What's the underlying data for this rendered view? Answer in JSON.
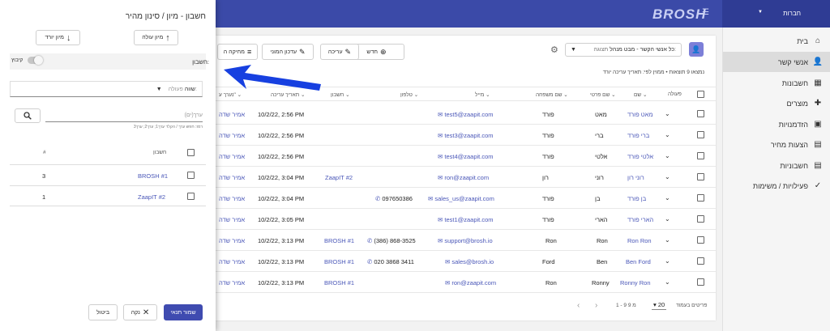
{
  "header": {
    "logo": "BROSH",
    "menu_icon": "menu-collapse-icon",
    "company": "חברות"
  },
  "sidebar": {
    "items": [
      {
        "label": "בית",
        "icon": "⌂"
      },
      {
        "label": "אנשי קשר",
        "icon": "👤"
      },
      {
        "label": "חשבונות",
        "icon": "▦"
      },
      {
        "label": "מוצרים",
        "icon": "✚"
      },
      {
        "label": "הזדמנויות",
        "icon": "▣"
      },
      {
        "label": "הצעות מחיר",
        "icon": "▤"
      },
      {
        "label": "חשבוניות",
        "icon": "▤"
      },
      {
        "label": "פעילויות / משימות",
        "icon": "✓"
      }
    ]
  },
  "toolbar": {
    "new": "חדש",
    "edit": "עריכה",
    "mass_update": "עדכון המוני",
    "delete": "מחיקה ה"
  },
  "view": {
    "label": "תצוגה:",
    "value": "כל אנשי הקשר - מבט מנהל"
  },
  "results_text": "נמצאו 9 תוצאות • ממוין לפי: תאריך עריכה יורד",
  "table": {
    "headers": {
      "action": "פעולה",
      "name": "שם",
      "first_name": "שם פרטי",
      "last_name": "שם משפחה",
      "email": "מייל",
      "phone": "טלפון",
      "account": "חשבון",
      "modified": "תאריך עריכה",
      "modified_by": "נערך ע\""
    },
    "rows": [
      {
        "name": "מאט פורד",
        "first": "מאט",
        "last": "פורד",
        "email": "test5@zaapit.com",
        "phone": "",
        "account": "",
        "account_num": "",
        "date": "10/2/22, 2:56 PM",
        "by": "אמיר שדה"
      },
      {
        "name": "ברי פורד",
        "first": "ברי",
        "last": "פורד",
        "email": "test3@zaapit.com",
        "phone": "",
        "account": "",
        "account_num": "",
        "date": "10/2/22, 2:56 PM",
        "by": "אמיר שדה"
      },
      {
        "name": "אלטי פורד",
        "first": "אלטי",
        "last": "פורד",
        "email": "test4@zaapit.com",
        "phone": "",
        "account": "",
        "account_num": "",
        "date": "10/2/22, 2:56 PM",
        "by": "אמיר שדה"
      },
      {
        "name": "רוני רון",
        "first": "רוני",
        "last": "רון",
        "email": "ron@zaapit.com",
        "phone": "",
        "account": "ZaapIT",
        "account_num": "#2",
        "date": "10/2/22, 3:04 PM",
        "by": "אמיר שדה"
      },
      {
        "name": "בן פורד",
        "first": "בן",
        "last": "פורד",
        "email": "sales_us@zaapit.com",
        "phone": "097650386",
        "account": "",
        "account_num": "",
        "date": "10/2/22, 3:04 PM",
        "by": "אמיר שדה"
      },
      {
        "name": "הארי פורד",
        "first": "הארי",
        "last": "פורד",
        "email": "test1@zaapit.com",
        "phone": "",
        "account": "",
        "account_num": "",
        "date": "10/2/22, 3:05 PM",
        "by": "אמיר שדה"
      },
      {
        "name": "Ron Ron",
        "first": "Ron",
        "last": "Ron",
        "email": "support@brosh.io",
        "phone": "(386) 868-3525",
        "account": "BROSH",
        "account_num": "#1",
        "date": "10/2/22, 3:13 PM",
        "by": "אמיר שדה"
      },
      {
        "name": "Ben Ford",
        "first": "Ben",
        "last": "Ford",
        "email": "sales@brosh.io",
        "phone": "020 3868 3411",
        "account": "BROSH",
        "account_num": "#1",
        "date": "10/2/22, 3:13 PM",
        "by": "אמיר שדה"
      },
      {
        "name": "Ronny Ron",
        "first": "Ronny",
        "last": "Ron",
        "email": "ron@zaapit.com",
        "phone": "",
        "account": "BROSH",
        "account_num": "#1",
        "date": "10/2/22, 3:13 PM",
        "by": "אמיר שדה"
      }
    ]
  },
  "pagination": {
    "label": "פריטים בעמוד",
    "per_page": "20",
    "range": "1 - 9 מ 9"
  },
  "drawer": {
    "title": "חשבון - מיון / סינון מהיר",
    "sort_asc": "מיון עולה",
    "sort_desc": "מיון יורד",
    "field_label": "חשבון:",
    "group_label": "קיבוץ",
    "operator_label": "פעולה:",
    "operator_value": "שווה",
    "value_placeholder": "ערך(ים)",
    "hint": "רמז: חפש ערך / הקלד ערך1; ערך2; ערך3",
    "list_headers": {
      "account": "חשבון",
      "count": "#"
    },
    "list": [
      {
        "name": "BROSH",
        "num": "#1",
        "count": "3"
      },
      {
        "name": "ZaapIT",
        "num": "#2",
        "count": "1"
      }
    ],
    "save": "שמור תנאי",
    "clear": "נקה",
    "cancel": "ביטול"
  }
}
